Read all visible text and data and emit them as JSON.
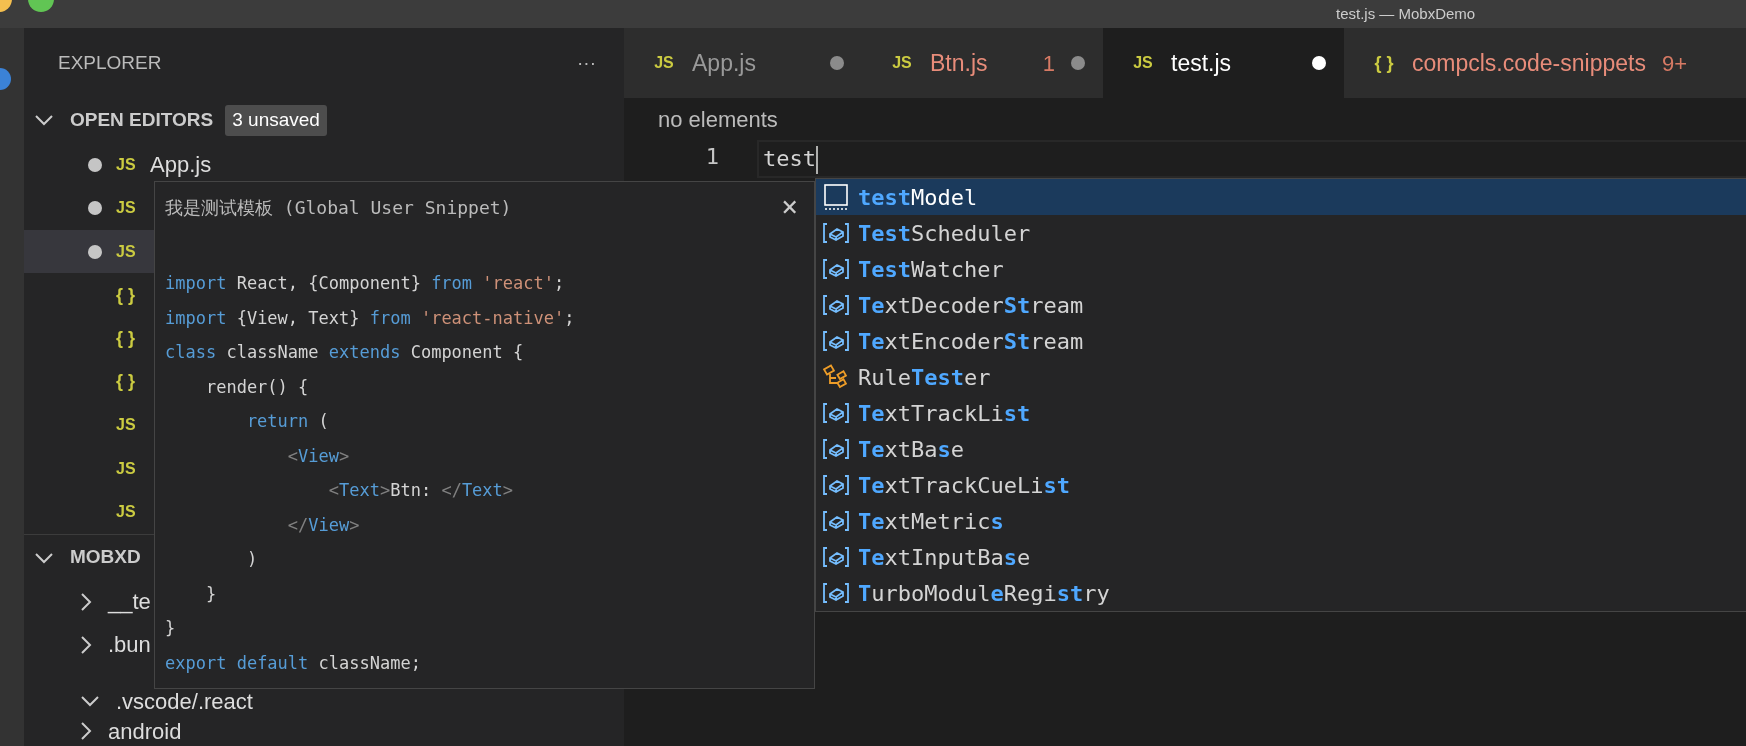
{
  "window": {
    "title": "test.js — MobxDemo"
  },
  "sidebar": {
    "title": "EXPLORER",
    "more": "···",
    "open_editors": {
      "title": "OPEN EDITORS",
      "expanded": true,
      "badge": "3 unsaved",
      "items": [
        {
          "icon_text": "JS",
          "kind": "js",
          "name": "App.js",
          "unsaved": true,
          "selected": false
        },
        {
          "icon_text": "JS",
          "kind": "js",
          "unsaved": true,
          "selected": false
        },
        {
          "icon_text": "JS",
          "kind": "js",
          "unsaved": true,
          "selected": true
        },
        {
          "icon_text": "{ }",
          "kind": "json",
          "unsaved": false,
          "selected": false
        },
        {
          "icon_text": "{ }",
          "kind": "json",
          "unsaved": false,
          "selected": false
        },
        {
          "icon_text": "{ }",
          "kind": "json",
          "unsaved": false,
          "selected": false
        },
        {
          "icon_text": "JS",
          "kind": "js",
          "unsaved": false,
          "selected": false
        },
        {
          "icon_text": "JS",
          "kind": "js",
          "unsaved": false,
          "selected": false
        },
        {
          "icon_text": "JS",
          "kind": "js",
          "unsaved": false,
          "selected": false
        }
      ]
    },
    "project": {
      "title": "MOBXD",
      "expanded": true,
      "items": [
        {
          "name": "__te",
          "expanded": false
        },
        {
          "name": ".bun",
          "expanded": false
        },
        {
          "name": ".vscode/.react",
          "expanded": true
        },
        {
          "name": "android",
          "expanded": false
        }
      ]
    }
  },
  "tabs": [
    {
      "icon_text": "JS",
      "kind": "js",
      "label": "App.js",
      "has_errors": false,
      "modified": true,
      "selected": false
    },
    {
      "icon_text": "JS",
      "kind": "js",
      "label": "Btn.js",
      "has_errors": true,
      "problems": "1",
      "modified": true,
      "selected": false
    },
    {
      "icon_text": "JS",
      "kind": "js",
      "label": "test.js",
      "has_errors": false,
      "modified": true,
      "selected": true
    },
    {
      "icon_text": "{ }",
      "kind": "json",
      "label": "compcls.code-snippets",
      "has_errors": true,
      "problems": "9+",
      "modified": false,
      "selected": false
    }
  ],
  "breadcrumb": "no elements",
  "editor": {
    "lines": [
      {
        "number": "1",
        "text": "test"
      }
    ]
  },
  "snippet_popup": {
    "title": "我是测试模板 (Global User Snippet)",
    "close": "×",
    "lines": [
      {
        "tokens": [
          {
            "kind": "keyword",
            "text": "import"
          },
          {
            "kind": "plain",
            "text": " React, {Component} "
          },
          {
            "kind": "keyword",
            "text": "from"
          },
          {
            "kind": "string",
            "text": " 'react'"
          },
          {
            "kind": "plain",
            "text": ";"
          }
        ]
      },
      {
        "tokens": [
          {
            "kind": "keyword",
            "text": "import"
          },
          {
            "kind": "plain",
            "text": " {View, Text} "
          },
          {
            "kind": "keyword",
            "text": "from"
          },
          {
            "kind": "string",
            "text": " 'react-native'"
          },
          {
            "kind": "plain",
            "text": ";"
          }
        ]
      },
      {
        "tokens": [
          {
            "kind": "keyword",
            "text": "class"
          },
          {
            "kind": "plain",
            "text": " className "
          },
          {
            "kind": "keyword",
            "text": "extends"
          },
          {
            "kind": "plain",
            "text": " Component {"
          }
        ]
      },
      {
        "tokens": [
          {
            "kind": "plain",
            "text": "    render() {"
          }
        ]
      },
      {
        "tokens": [
          {
            "kind": "keyword",
            "text": "        return"
          },
          {
            "kind": "plain",
            "text": " ("
          }
        ]
      },
      {
        "tokens": [
          {
            "kind": "bracket",
            "text": "            <"
          },
          {
            "kind": "tag",
            "text": "View"
          },
          {
            "kind": "bracket",
            "text": ">"
          }
        ]
      },
      {
        "tokens": [
          {
            "kind": "bracket",
            "text": "                <"
          },
          {
            "kind": "tag",
            "text": "Text"
          },
          {
            "kind": "bracket",
            "text": ">"
          },
          {
            "kind": "plain",
            "text": "Btn: "
          },
          {
            "kind": "bracket",
            "text": "</"
          },
          {
            "kind": "tag",
            "text": "Text"
          },
          {
            "kind": "bracket",
            "text": ">"
          }
        ]
      },
      {
        "tokens": [
          {
            "kind": "bracket",
            "text": "            </"
          },
          {
            "kind": "tag",
            "text": "View"
          },
          {
            "kind": "bracket",
            "text": ">"
          }
        ]
      },
      {
        "tokens": [
          {
            "kind": "plain",
            "text": "        )"
          }
        ]
      },
      {
        "tokens": [
          {
            "kind": "plain",
            "text": "    }"
          }
        ]
      },
      {
        "tokens": [
          {
            "kind": "plain",
            "text": "}"
          }
        ]
      },
      {
        "tokens": [
          {
            "kind": "keyword",
            "text": "export"
          },
          {
            "kind": "keyword",
            "text": " default"
          },
          {
            "kind": "plain",
            "text": " className;"
          }
        ]
      }
    ]
  },
  "suggestions": [
    {
      "kind": "snippet",
      "selected": true,
      "parts": [
        {
          "text": "test",
          "match": true
        },
        {
          "text": "Model",
          "match": false
        }
      ]
    },
    {
      "kind": "variable",
      "selected": false,
      "parts": [
        {
          "text": "Test",
          "match": true
        },
        {
          "text": "Scheduler",
          "match": false
        }
      ]
    },
    {
      "kind": "variable",
      "selected": false,
      "parts": [
        {
          "text": "Test",
          "match": true
        },
        {
          "text": "Watcher",
          "match": false
        }
      ]
    },
    {
      "kind": "variable",
      "selected": false,
      "parts": [
        {
          "text": "Te",
          "match": true
        },
        {
          "text": "xtDecoder",
          "match": false
        },
        {
          "text": "St",
          "match": true
        },
        {
          "text": "ream",
          "match": false
        }
      ]
    },
    {
      "kind": "variable",
      "selected": false,
      "parts": [
        {
          "text": "Te",
          "match": true
        },
        {
          "text": "xtEncoder",
          "match": false
        },
        {
          "text": "St",
          "match": true
        },
        {
          "text": "ream",
          "match": false
        }
      ]
    },
    {
      "kind": "class",
      "selected": false,
      "parts": [
        {
          "text": "Rule",
          "match": false
        },
        {
          "text": "Test",
          "match": true
        },
        {
          "text": "er",
          "match": false
        }
      ]
    },
    {
      "kind": "variable",
      "selected": false,
      "parts": [
        {
          "text": "Te",
          "match": true
        },
        {
          "text": "xtTrackLi",
          "match": false
        },
        {
          "text": "st",
          "match": true
        }
      ]
    },
    {
      "kind": "variable",
      "selected": false,
      "parts": [
        {
          "text": "Te",
          "match": true
        },
        {
          "text": "xtBa",
          "match": false
        },
        {
          "text": "s",
          "match": true
        },
        {
          "text": "e",
          "match": false
        }
      ]
    },
    {
      "kind": "variable",
      "selected": false,
      "parts": [
        {
          "text": "Te",
          "match": true
        },
        {
          "text": "xtTrackCueLi",
          "match": false
        },
        {
          "text": "st",
          "match": true
        }
      ]
    },
    {
      "kind": "variable",
      "selected": false,
      "parts": [
        {
          "text": "Te",
          "match": true
        },
        {
          "text": "xtMetric",
          "match": false
        },
        {
          "text": "s",
          "match": true
        }
      ]
    },
    {
      "kind": "variable",
      "selected": false,
      "parts": [
        {
          "text": "Te",
          "match": true
        },
        {
          "text": "xtInputBa",
          "match": false
        },
        {
          "text": "s",
          "match": true
        },
        {
          "text": "e",
          "match": false
        }
      ]
    },
    {
      "kind": "variable",
      "selected": false,
      "parts": [
        {
          "text": "T",
          "match": true
        },
        {
          "text": "urboModul",
          "match": false
        },
        {
          "text": "e",
          "match": true
        },
        {
          "text": "Regi",
          "match": false
        },
        {
          "text": "st",
          "match": true
        },
        {
          "text": "ry",
          "match": false
        }
      ]
    }
  ]
}
